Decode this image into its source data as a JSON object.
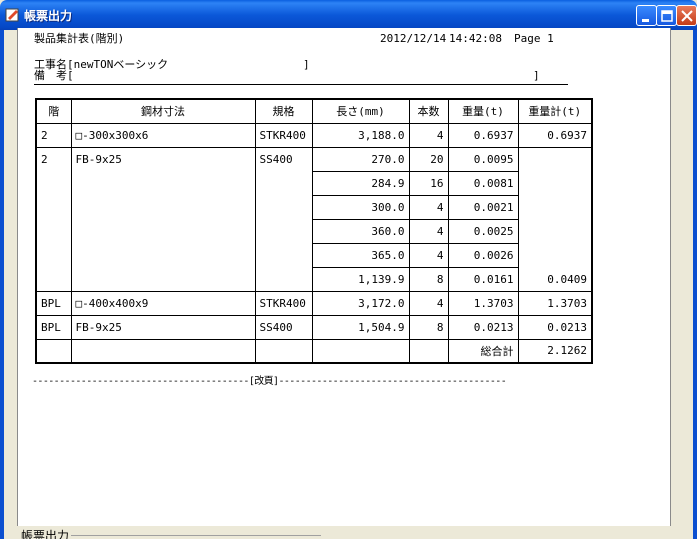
{
  "window": {
    "title": "帳票出力",
    "colors": {
      "titlebar": "#0b58d9",
      "close": "#c43b17",
      "body": "#ece9d8"
    }
  },
  "report": {
    "heading": "製品集計表(階別)",
    "date": "2012/12/14",
    "time": "14:42:08",
    "page": "Page 1",
    "project_line": "工事名[newTONベーシック",
    "project_close": "]",
    "remarks_line": "備　考[",
    "remarks_close": "]",
    "page_break": "----------------------------------------[改頁]------------------------------------------"
  },
  "table": {
    "headers": [
      "階",
      "鋼材寸法",
      "規格",
      "長さ(mm)",
      "本数",
      "重量(t)",
      "重量計(t)"
    ],
    "rows": [
      {
        "floor": "2",
        "size": "□-300x300x6",
        "spec": "STKR400",
        "length": "3,188.0",
        "count": "4",
        "weight": "0.6937",
        "total": "0.6937"
      },
      {
        "floor": "2",
        "size": "FB-9x25",
        "spec": "SS400",
        "length": "270.0",
        "count": "20",
        "weight": "0.0095",
        "total": ""
      },
      {
        "length": "284.9",
        "count": "16",
        "weight": "0.0081"
      },
      {
        "length": "300.0",
        "count": "4",
        "weight": "0.0021"
      },
      {
        "length": "360.0",
        "count": "4",
        "weight": "0.0025"
      },
      {
        "length": "365.0",
        "count": "4",
        "weight": "0.0026"
      },
      {
        "length": "1,139.9",
        "count": "8",
        "weight": "0.0161",
        "total": "0.0409"
      },
      {
        "floor": "BPL",
        "size": "□-400x400x9",
        "spec": "STKR400",
        "length": "3,172.0",
        "count": "4",
        "weight": "1.3703",
        "total": "1.3703"
      },
      {
        "floor": "BPL",
        "size": "FB-9x25",
        "spec": "SS400",
        "length": "1,504.9",
        "count": "8",
        "weight": "0.0213",
        "total": "0.0213"
      }
    ],
    "grand_total_label": "総合計",
    "grand_total": "2.1262"
  },
  "groupbox": {
    "label": "帳票出力"
  }
}
